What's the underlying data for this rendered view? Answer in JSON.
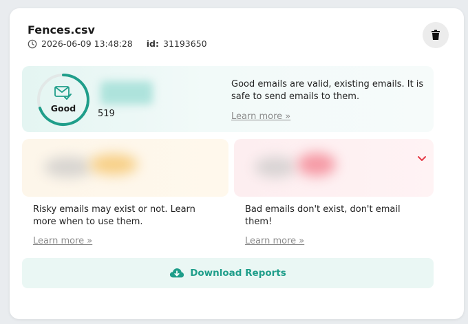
{
  "file": {
    "name": "Fences.csv",
    "timestamp": "2026-06-09 13:48:28",
    "id_label": "id:",
    "id_value": "31193650"
  },
  "good": {
    "ring_label": "Good",
    "count": "519",
    "description": "Good emails are valid, existing emails. It is safe to send emails to them.",
    "learn_more": "Learn more »"
  },
  "risky": {
    "description": "Risky emails may exist or not. Learn more when to use them.",
    "learn_more": "Learn more »"
  },
  "bad": {
    "description": "Bad emails don't exist, don't email them!",
    "learn_more": "Learn more »"
  },
  "download": {
    "label": "Download Reports"
  },
  "colors": {
    "accent": "#1f9e8a",
    "risky": "#f7cf86",
    "bad": "#e53946"
  },
  "icons": {
    "clock": "clock-icon",
    "delete": "trash-icon",
    "good": "mail-check-icon",
    "expand": "chevron-down-icon",
    "download": "cloud-download-icon"
  }
}
